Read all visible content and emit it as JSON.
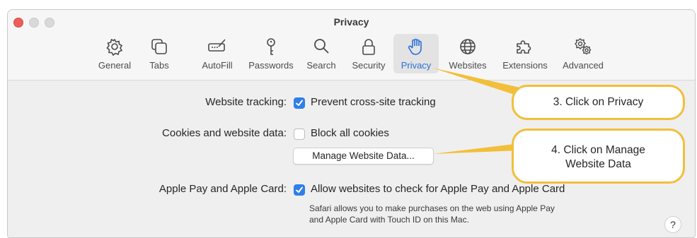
{
  "window": {
    "title": "Privacy"
  },
  "toolbar": {
    "tabs": [
      {
        "label": "General",
        "icon": "gear-icon"
      },
      {
        "label": "Tabs",
        "icon": "tabs-icon"
      },
      {
        "label": "AutoFill",
        "icon": "autofill-icon"
      },
      {
        "label": "Passwords",
        "icon": "key-icon"
      },
      {
        "label": "Search",
        "icon": "search-icon"
      },
      {
        "label": "Security",
        "icon": "lock-icon"
      },
      {
        "label": "Privacy",
        "icon": "hand-icon",
        "active": true
      },
      {
        "label": "Websites",
        "icon": "globe-icon"
      },
      {
        "label": "Extensions",
        "icon": "puzzle-icon"
      },
      {
        "label": "Advanced",
        "icon": "gears-icon"
      }
    ]
  },
  "privacy": {
    "tracking": {
      "label": "Website tracking:",
      "option": "Prevent cross-site tracking",
      "checked": true
    },
    "cookies": {
      "label": "Cookies and website data:",
      "option": "Block all cookies",
      "checked": false,
      "manage_button": "Manage Website Data..."
    },
    "apple_pay": {
      "label": "Apple Pay and Apple Card:",
      "option": "Allow websites to check for Apple Pay and Apple Card",
      "checked": true,
      "note_line1": "Safari allows you to make purchases on the web using Apple Pay",
      "note_line2": "and Apple Card with Touch ID on this Mac."
    },
    "help": "?"
  },
  "annotations": {
    "step3": "3. Click on Privacy",
    "step4_line1": "4. Click on Manage",
    "step4_line2": "Website Data"
  },
  "colors": {
    "accent": "#2f7fe8",
    "active_tab_text": "#2a6fd8",
    "callout_border": "#f2bf3a",
    "close_button": "#ec5f58"
  }
}
